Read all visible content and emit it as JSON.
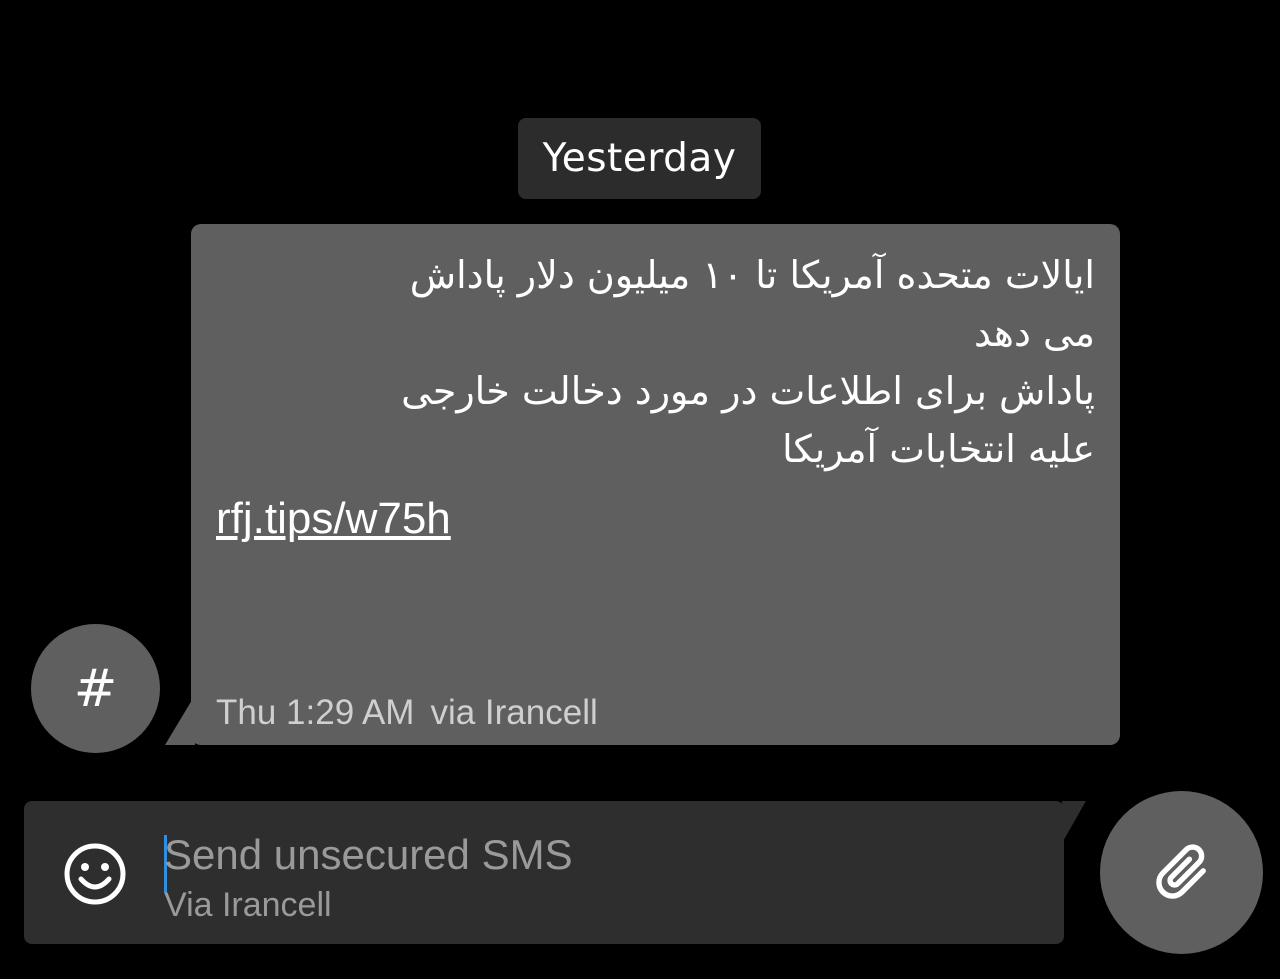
{
  "conversation": {
    "date_separator": "Yesterday"
  },
  "message": {
    "lines": [
      "ایالات متحده آمریکا تا ۱۰ میلیون دلار پاداش",
      "می دهد",
      "پاداش برای اطلاعات در مورد دخالت خارجی",
      "علیه انتخابات آمریکا"
    ],
    "link": "rfj.tips/w75h",
    "time": "Thu 1:29 AM",
    "via": "via Irancell"
  },
  "sender": {
    "avatar_glyph": "#"
  },
  "composer": {
    "placeholder": "Send unsecured SMS",
    "subline": "Via Irancell",
    "emoji_icon": "smiley-face-icon",
    "attach_icon": "paperclip-icon"
  },
  "colors": {
    "background": "#000000",
    "bubble": "#5f5f5f",
    "chip": "#2c2c2c",
    "composer": "#2e2e2e",
    "cursor": "#2f8fe0"
  }
}
